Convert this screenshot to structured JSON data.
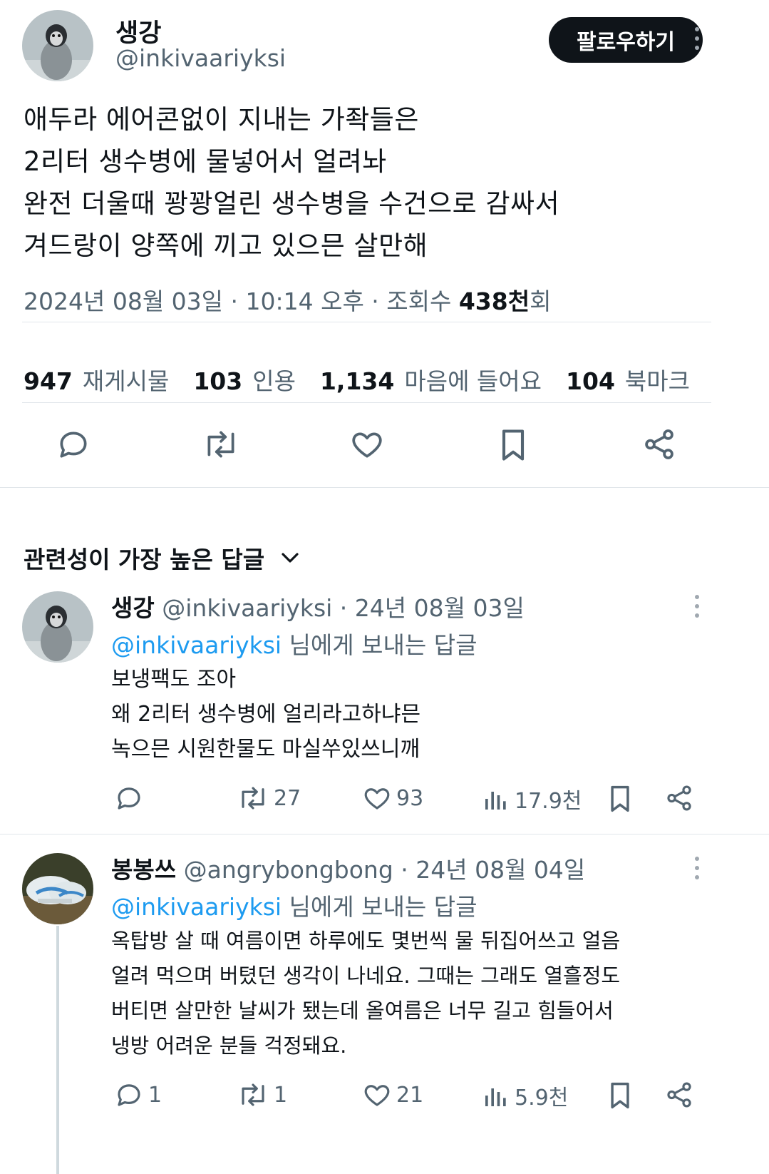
{
  "tweet": {
    "display_name": "생강",
    "handle": "@inkivaariyksi",
    "follow_label": "팔로우하기",
    "text": "애두라 에어콘없이 지내는 가좍들은\n2리터 생수병에 물넣어서 얼려놔\n완전 더울때 꽝꽝얼린 생수병을 수건으로 감싸서\n겨드랑이 양쪽에 끼고 있으믄 살만해",
    "date_time": "2024년 08월 03일 · 10:14 오후 · 조회수 ",
    "views": "438천",
    "views_suffix": "회",
    "stats": {
      "reposts_count": "947",
      "reposts_label": "재게시물",
      "quotes_count": "103",
      "quotes_label": "인용",
      "likes_count": "1,134",
      "likes_label": "마음에 들어요",
      "bookmarks_count": "104",
      "bookmarks_label": "북마크"
    },
    "actions": {
      "reply_icon": "reply-icon",
      "repost_icon": "repost-icon",
      "like_icon": "heart-icon",
      "bookmark_icon": "bookmark-icon",
      "share_icon": "share-icon"
    }
  },
  "sort": {
    "label": "관련성이 가장 높은 답글"
  },
  "replies": [
    {
      "display_name": "생강",
      "handle": "@inkivaariyksi",
      "date": " · 24년 08월 03일",
      "reply_to_handle": "@inkivaariyksi",
      "reply_to_suffix": " 님에게 보내는 답글",
      "text": "보냉팩도 조아\n왜 2리터 생수병에 얼리라고하냐믄\n녹으믄 시원한물도 마실쑤있쓰니깨",
      "reply_count": "",
      "repost_count": "27",
      "like_count": "93",
      "view_count": "17.9천"
    },
    {
      "display_name": "봉봉쓰",
      "handle": "@angrybongbong",
      "date": " · 24년 08월 04일",
      "reply_to_handle": "@inkivaariyksi",
      "reply_to_suffix": " 님에게 보내는 답글",
      "text": "옥탑방 살 때 여름이면 하루에도 몇번씩 물 뒤집어쓰고 얼음\n얼려 먹으며 버텼던 생각이 나네요. 그때는 그래도 열흘정도\n버티면 살만한 날씨가 됐는데 올여름은 너무 길고 힘들어서\n냉방 어려운 분들 걱정돼요.",
      "reply_count": "1",
      "repost_count": "1",
      "like_count": "21",
      "view_count": "5.9천"
    }
  ],
  "colors": {
    "accent": "#1d9bf0",
    "muted": "#536471",
    "text": "#0f1419"
  }
}
